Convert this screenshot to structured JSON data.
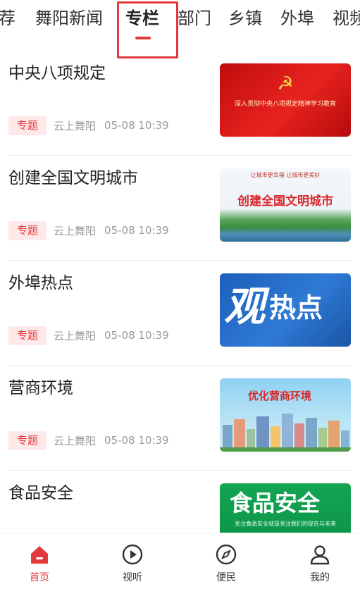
{
  "tabs": [
    {
      "label": "荐"
    },
    {
      "label": "舞阳新闻"
    },
    {
      "label": "专栏",
      "active": true
    },
    {
      "label": "部门"
    },
    {
      "label": "乡镇"
    },
    {
      "label": "外埠"
    },
    {
      "label": "视频"
    }
  ],
  "items": [
    {
      "title": "中央八项规定",
      "tag": "专题",
      "source": "云上舞阳",
      "time": "05-08 10:39",
      "thumb_caption": "深入贯彻中央八项规定精神学习教育"
    },
    {
      "title": "创建全国文明城市",
      "tag": "专题",
      "source": "云上舞阳",
      "time": "05-08 10:39",
      "thumb_small": "让城市更幸福  让城市更美好",
      "thumb_caption": "创建全国文明城市"
    },
    {
      "title": "外埠热点",
      "tag": "专题",
      "source": "云上舞阳",
      "time": "05-08 10:39",
      "thumb_caption_a": "观",
      "thumb_caption_b": "热点"
    },
    {
      "title": "营商环境",
      "tag": "专题",
      "source": "云上舞阳",
      "time": "05-08 10:39",
      "thumb_caption": "优化营商环境"
    },
    {
      "title": "食品安全",
      "thumb_caption": "食品安全",
      "thumb_small": "关注食品安全就是关注我们的现在与未来"
    }
  ],
  "nav": [
    {
      "label": "首页",
      "icon": "home-icon",
      "active": true
    },
    {
      "label": "视听",
      "icon": "play-circle-icon"
    },
    {
      "label": "便民",
      "icon": "compass-icon"
    },
    {
      "label": "我的",
      "icon": "user-icon"
    }
  ],
  "colors": {
    "accent": "#e4393c",
    "tag_bg": "#fde9e9",
    "meta_text": "#9a9a9a"
  }
}
